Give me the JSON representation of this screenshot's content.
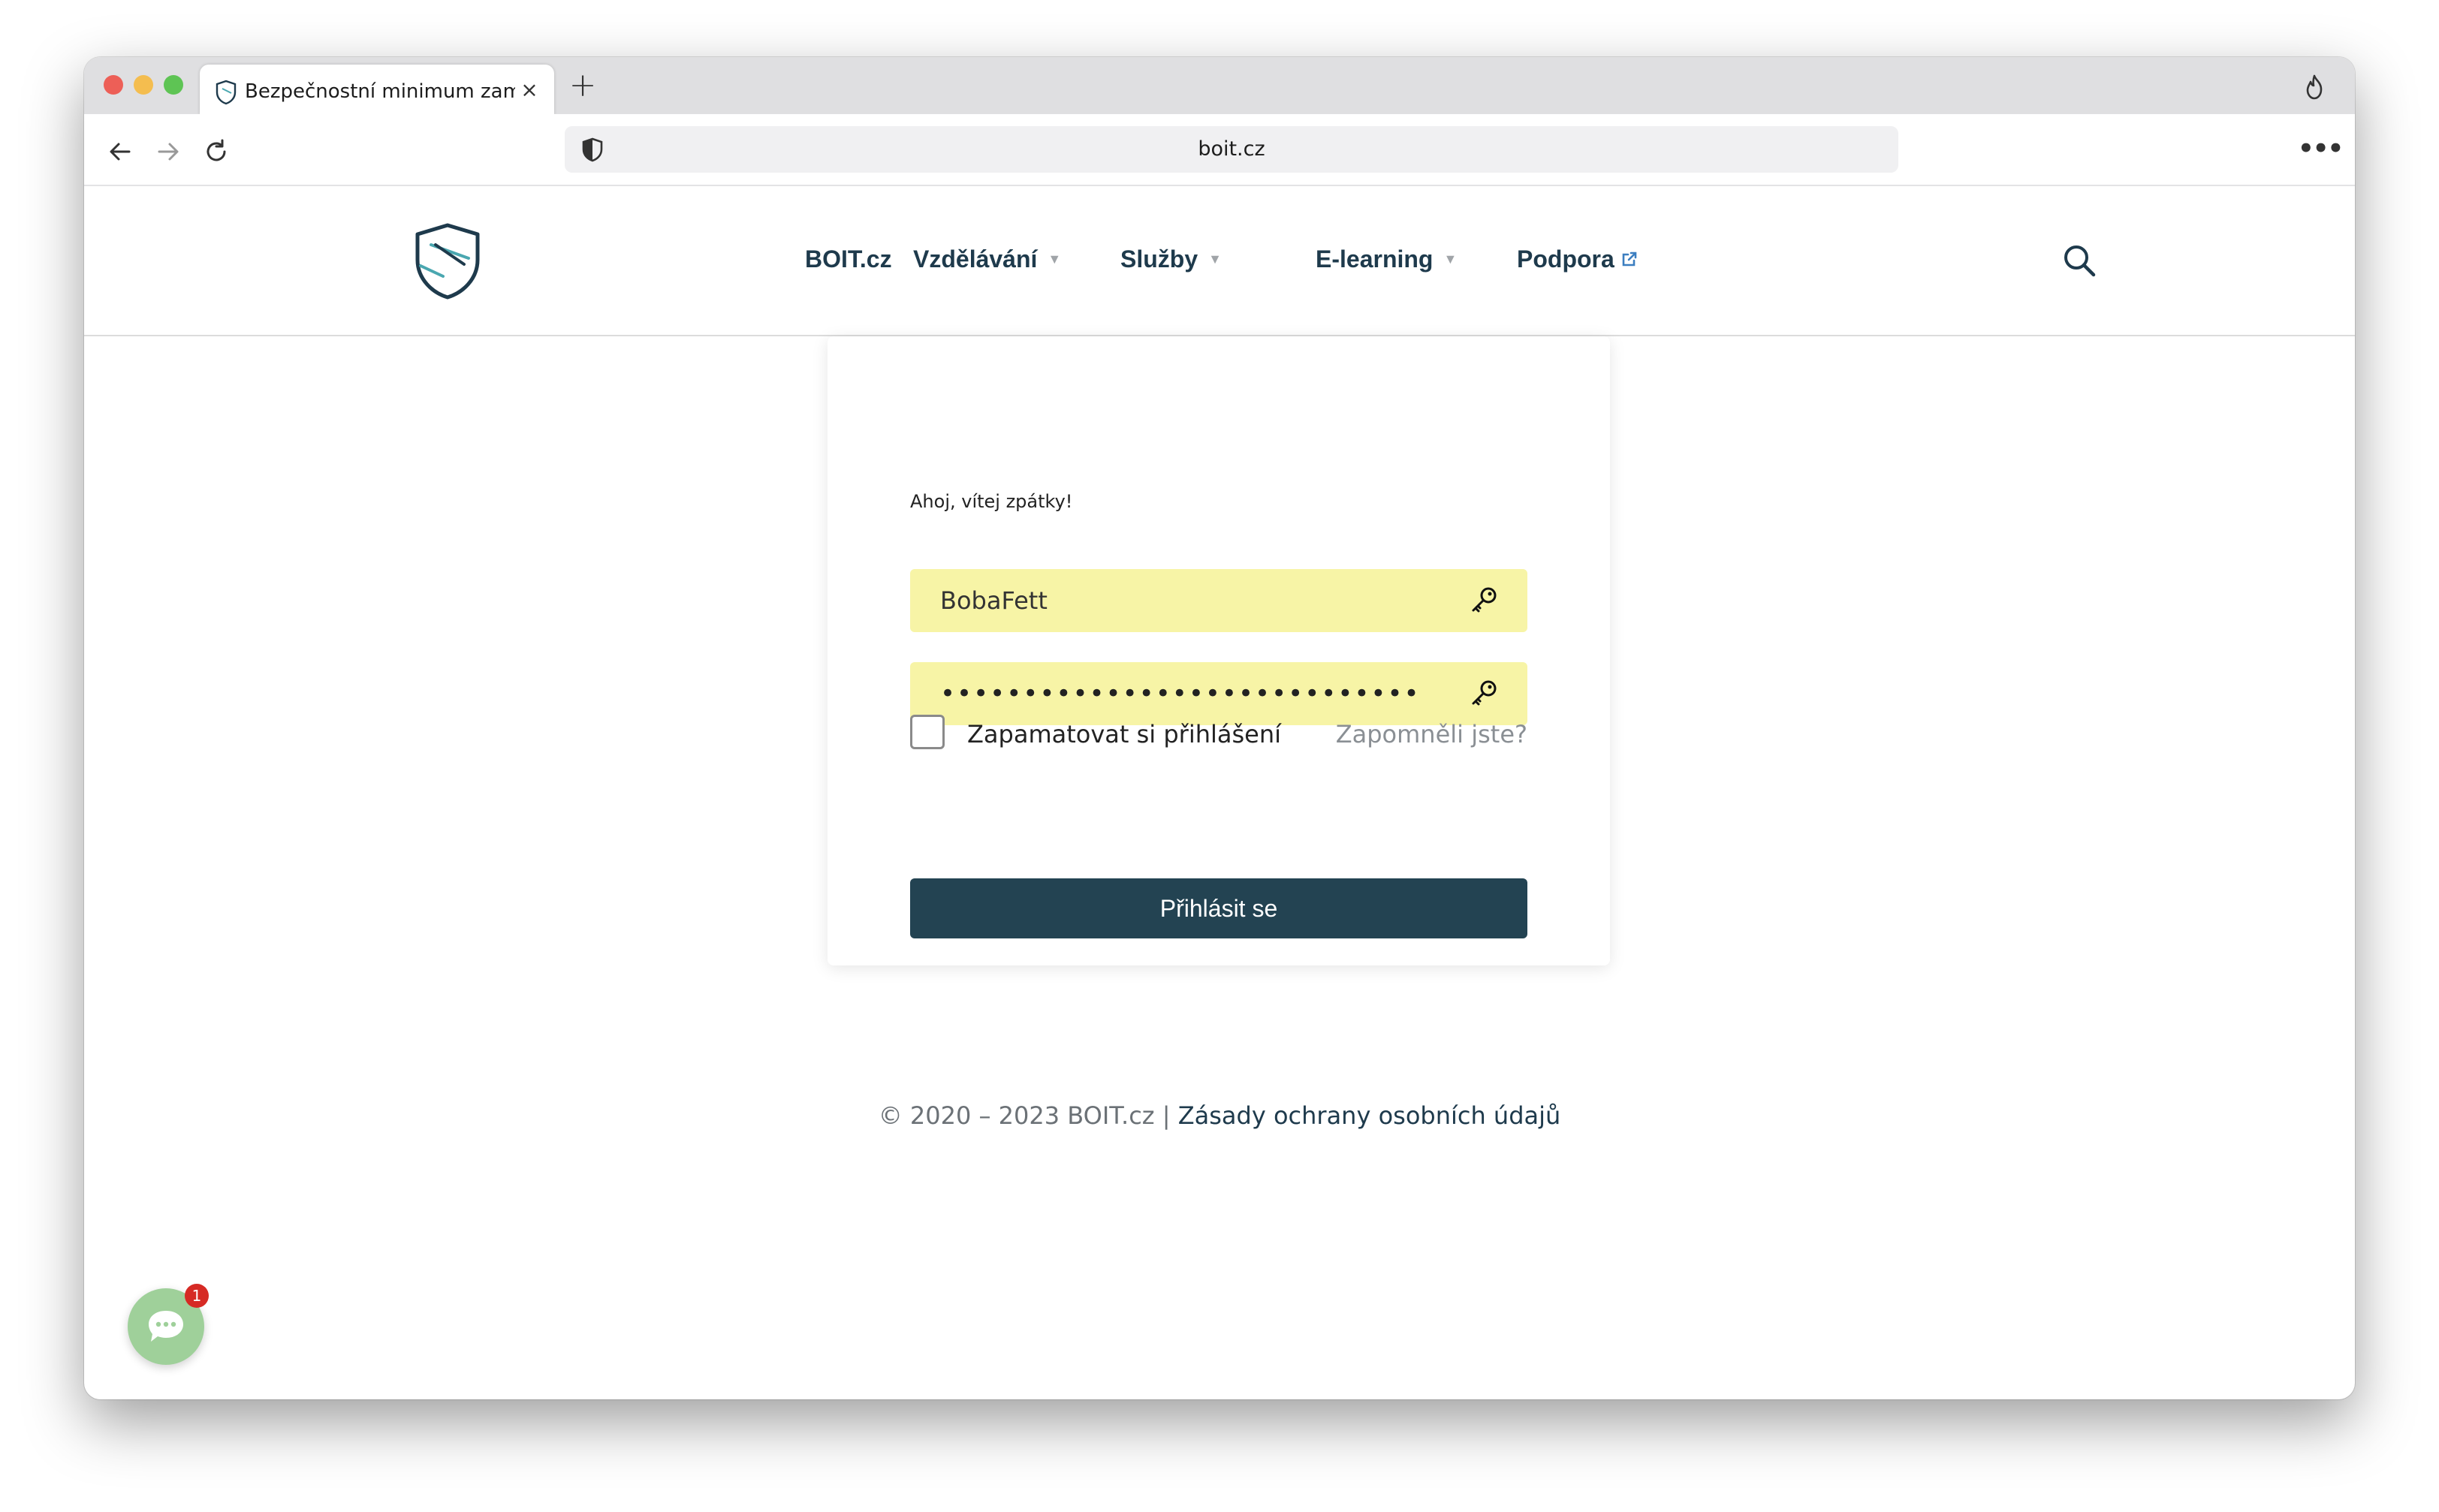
{
  "browser": {
    "tab_title": "Bezpečnostní minimum zaměstnance",
    "tab_close": "×",
    "new_tab": "+",
    "url": "boit.cz",
    "menu": "•••"
  },
  "site": {
    "nav": [
      {
        "label": "BOIT.cz"
      },
      {
        "label": "Vzdělávání",
        "caret": "▼"
      },
      {
        "label": "Služby",
        "caret": "▼"
      },
      {
        "label": "E-learning",
        "caret": "▼"
      },
      {
        "label": "Podpora"
      }
    ]
  },
  "login": {
    "greeting": "Ahoj, vítej zpátky!",
    "username_value": "BobaFett",
    "password_value": "•••••••••••••••••••••••••••••",
    "remember_label": "Zapamatovat si přihlášení",
    "forgot_label": "Zapomněli jste?",
    "submit_label": "Přihlásit se"
  },
  "footer": {
    "copyright": "© 2020 – 2023 BOIT.cz | ",
    "privacy_link": "Zásady ochrany osobních údajů"
  },
  "chat": {
    "badge_count": "1"
  },
  "colors": {
    "brand_dark": "#234352",
    "field_bg": "#f7f4a6",
    "chat_green": "#9fd09a",
    "badge_red": "#d62a24"
  }
}
